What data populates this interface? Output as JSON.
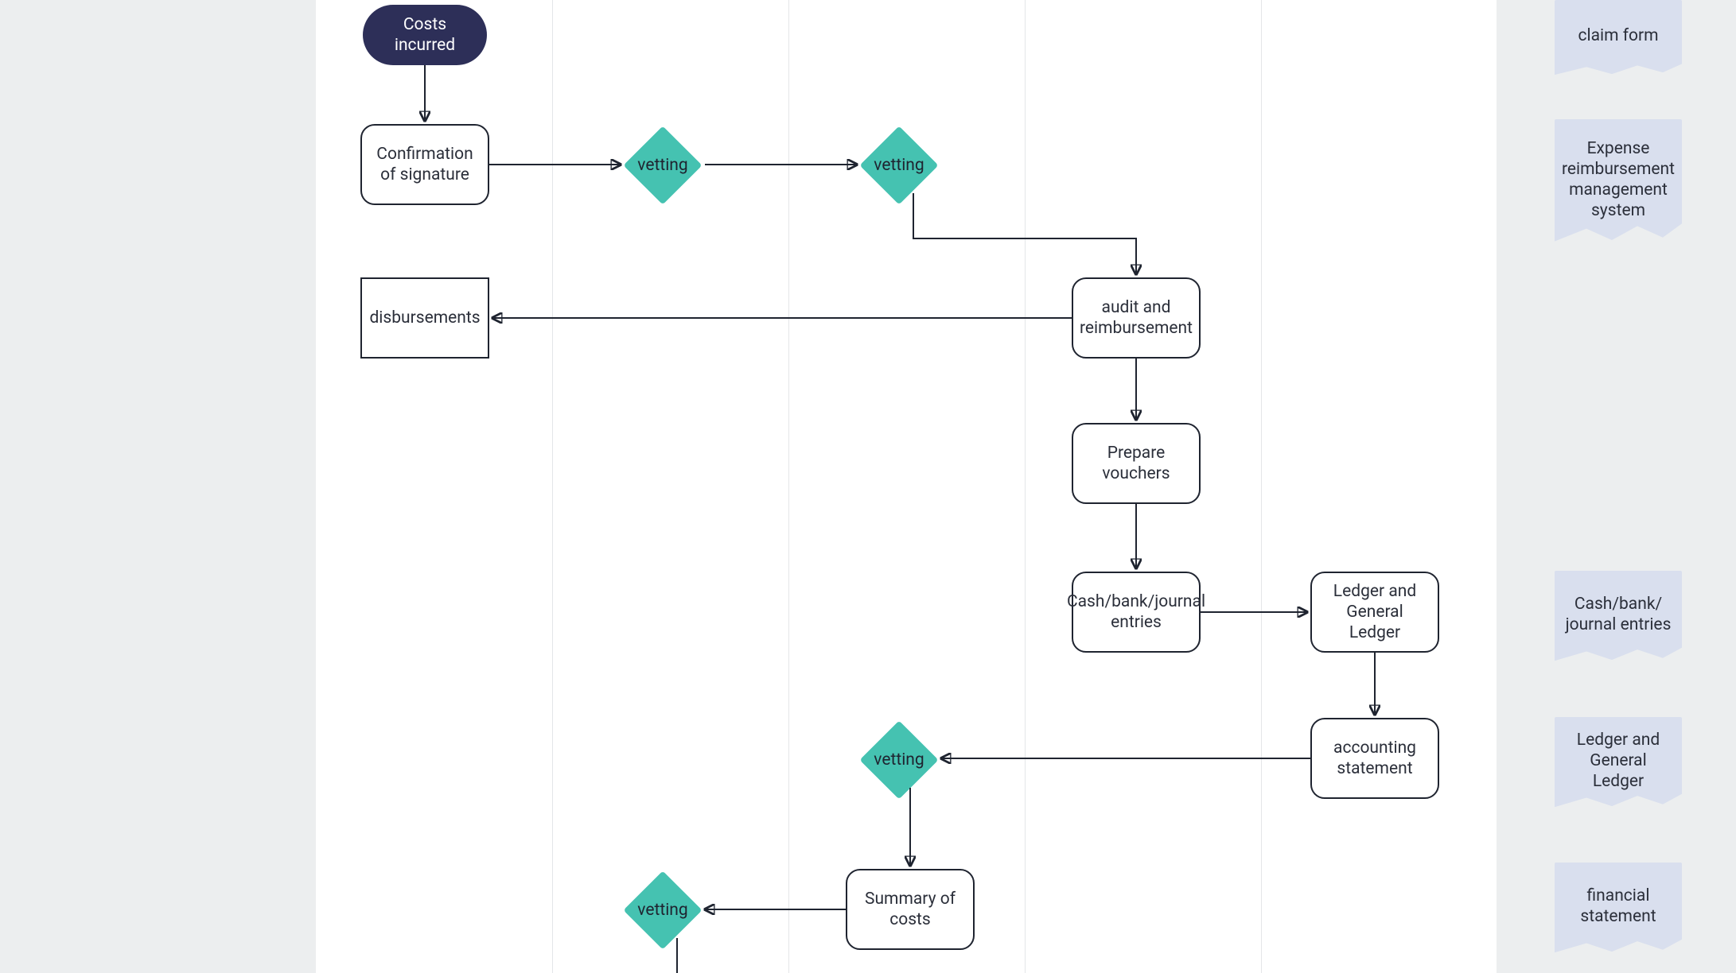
{
  "diagram": {
    "nodes": {
      "costs_incurred": "Costs incurred",
      "confirmation_signature": "Confirmation of signature",
      "vetting1": "vetting",
      "vetting2": "vetting",
      "audit_reimbursement": "audit and reimbursement",
      "disbursements": "disbursements",
      "prepare_vouchers": "Prepare vouchers",
      "cash_bank_journal": "Cash/bank/journal entries",
      "ledger_gl": "Ledger and General Ledger",
      "accounting_statement": "accounting statement",
      "vetting3": "vetting",
      "summary_costs": "Summary of costs",
      "vetting4": "vetting"
    },
    "side_docs": {
      "claim_form": "claim form",
      "erms": "Expense reimbursement management system",
      "cash_bank": "Cash/bank/ journal entries",
      "ledger_gl_doc": "Ledger and General Ledger",
      "financial_statement": "financial statement"
    }
  }
}
